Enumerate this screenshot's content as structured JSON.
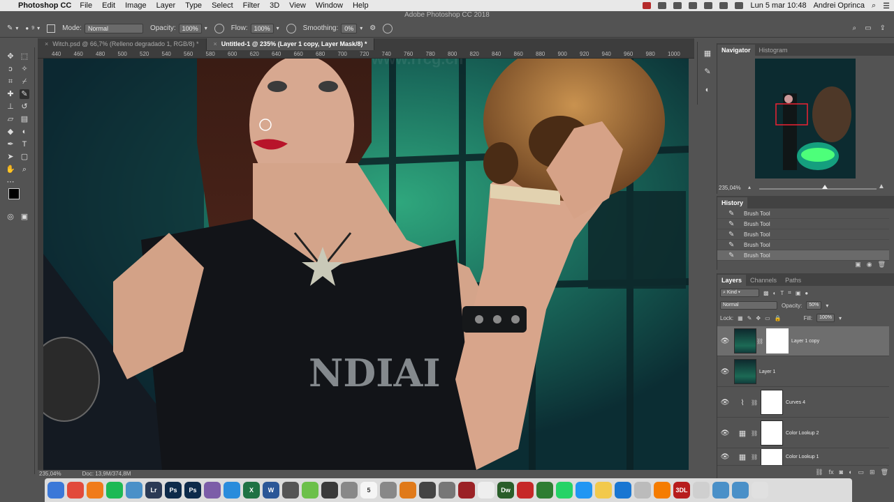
{
  "menubar": {
    "app_name": "Photoshop CC",
    "items": [
      "File",
      "Edit",
      "Image",
      "Layer",
      "Type",
      "Select",
      "Filter",
      "3D",
      "View",
      "Window",
      "Help"
    ],
    "datetime": "Lun 5 mar  10:48",
    "user": "Andrei Oprinca"
  },
  "app_title": "Adobe Photoshop CC 2018",
  "options": {
    "mode_label": "Mode:",
    "mode_value": "Normal",
    "opacity_label": "Opacity:",
    "opacity_value": "100%",
    "flow_label": "Flow:",
    "flow_value": "100%",
    "smoothing_label": "Smoothing:",
    "smoothing_value": "0%",
    "brush_size": "9"
  },
  "tabs": [
    {
      "label": "Witch.psd @ 66,7% (Relleno degradado 1, RGB/8) *"
    },
    {
      "label": "Untitled-1 @ 235% (Layer 1 copy, Layer Mask/8) *"
    }
  ],
  "ruler": [
    "440",
    "460",
    "480",
    "500",
    "520",
    "540",
    "560",
    "580",
    "600",
    "620",
    "640",
    "660",
    "680",
    "700",
    "720",
    "740",
    "760",
    "780",
    "800",
    "820",
    "840",
    "860",
    "880",
    "900",
    "920",
    "940",
    "960",
    "980",
    "1000"
  ],
  "status": {
    "zoom": "235,04%",
    "doc": "Doc: 13,9M/374,8M"
  },
  "navigator": {
    "tabs": [
      "Navigator",
      "Histogram"
    ],
    "zoom": "235,04%"
  },
  "history": {
    "title": "History",
    "items": [
      "Brush Tool",
      "Brush Tool",
      "Brush Tool",
      "Brush Tool",
      "Brush Tool"
    ]
  },
  "layers": {
    "tabs": [
      "Layers",
      "Channels",
      "Paths"
    ],
    "kind_label": "Kind",
    "blend_mode": "Normal",
    "opacity_label": "Opacity:",
    "opacity_value": "50%",
    "lock_label": "Lock:",
    "fill_label": "Fill:",
    "fill_value": "100%",
    "list": [
      {
        "name": "Layer 1 copy"
      },
      {
        "name": "Layer 1"
      },
      {
        "name": "Curves 4"
      },
      {
        "name": "Color Lookup 2"
      },
      {
        "name": "Color Lookup 1"
      }
    ]
  },
  "canvas_text": "NDIAI",
  "watermark": "www.rrcg.cn",
  "dock": [
    {
      "label": "",
      "color": "#3b78d8"
    },
    {
      "label": "",
      "color": "#e24a3b"
    },
    {
      "label": "",
      "color": "#f07b1a"
    },
    {
      "label": "",
      "color": "#1db954"
    },
    {
      "label": "",
      "color": "#4a90c8"
    },
    {
      "label": "Lr",
      "color": "#2b3a55"
    },
    {
      "label": "Ps",
      "color": "#0d2a4a"
    },
    {
      "label": "Ps",
      "color": "#0d2a4a"
    },
    {
      "label": "",
      "color": "#7c5da8"
    },
    {
      "label": "",
      "color": "#2a8cdc"
    },
    {
      "label": "X",
      "color": "#1f7244"
    },
    {
      "label": "W",
      "color": "#2b5797"
    },
    {
      "label": "",
      "color": "#555555"
    },
    {
      "label": "",
      "color": "#6cc04a"
    },
    {
      "label": "",
      "color": "#3a3a3a"
    },
    {
      "label": "",
      "color": "#888888"
    },
    {
      "label": "5",
      "color": "#f5f5f5"
    },
    {
      "label": "",
      "color": "#888888"
    },
    {
      "label": "",
      "color": "#e07a1a"
    },
    {
      "label": "",
      "color": "#444444"
    },
    {
      "label": "",
      "color": "#777777"
    },
    {
      "label": "",
      "color": "#9b2226"
    },
    {
      "label": "",
      "color": "#eeeeee"
    },
    {
      "label": "Dw",
      "color": "#2a5e2a"
    },
    {
      "label": "",
      "color": "#c62828"
    },
    {
      "label": "",
      "color": "#2e7d32"
    },
    {
      "label": "",
      "color": "#25d366"
    },
    {
      "label": "",
      "color": "#2196f3"
    },
    {
      "label": "",
      "color": "#f2c94c"
    },
    {
      "label": "",
      "color": "#1976d2"
    },
    {
      "label": "",
      "color": "#bbbbbb"
    },
    {
      "label": "",
      "color": "#f57c00"
    },
    {
      "label": "3DL",
      "color": "#b71c1c"
    },
    {
      "label": "",
      "color": "#cfcfcf"
    },
    {
      "label": "",
      "color": "#4a90c8"
    },
    {
      "label": "",
      "color": "#4a90c8"
    },
    {
      "label": "",
      "color": "#e0e0e0"
    }
  ]
}
